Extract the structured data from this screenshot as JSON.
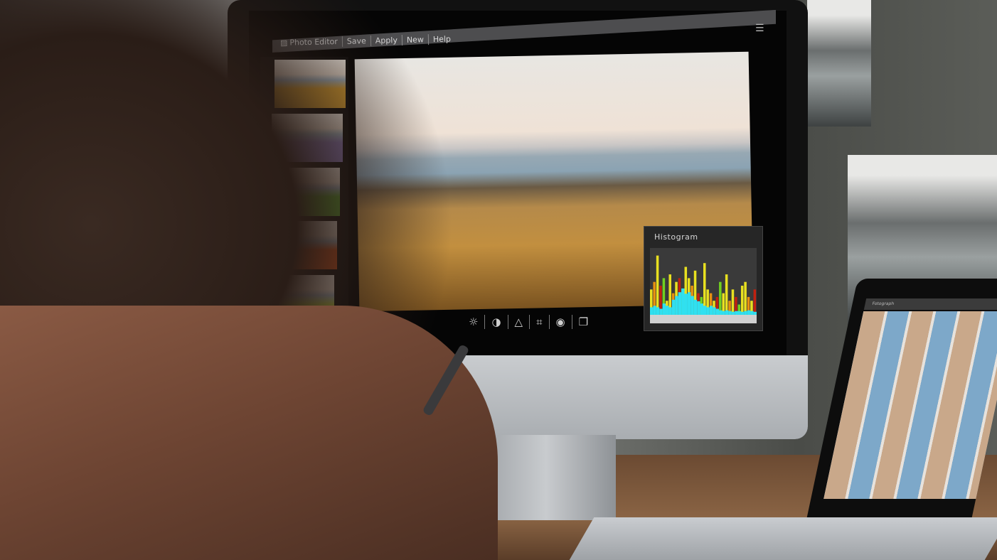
{
  "app": {
    "title": "Photo Editor",
    "menu": [
      "Save",
      "Apply",
      "New",
      "Help"
    ],
    "menu_icon": "image-icon",
    "hamburger_icon": "menu-icon"
  },
  "filmstrip": {
    "thumbnails": [
      {
        "name": "warm-golden-preset",
        "tint": "#d9a030"
      },
      {
        "name": "purple-blue-preset",
        "tint": "#8a78b8"
      },
      {
        "name": "green-preset",
        "tint": "#5aa830"
      },
      {
        "name": "red-orange-preset",
        "tint": "#d0501a"
      },
      {
        "name": "teal-yellow-preset",
        "tint": "#a8b840"
      }
    ]
  },
  "main_image": {
    "description": "Lakeside landscape with golden grass and snowy mountains"
  },
  "toolbar": {
    "tools": [
      {
        "name": "brightness",
        "icon": "sun-icon",
        "glyph": "☼"
      },
      {
        "name": "contrast",
        "icon": "contrast-icon",
        "glyph": "◑"
      },
      {
        "name": "sharpen",
        "icon": "triangle-icon",
        "glyph": "△"
      },
      {
        "name": "crop",
        "icon": "crop-icon",
        "glyph": "⌗"
      },
      {
        "name": "preview",
        "icon": "eye-icon",
        "glyph": "◉"
      },
      {
        "name": "compare",
        "icon": "copy-icon",
        "glyph": "❐"
      }
    ]
  },
  "histogram": {
    "title": "Histogram",
    "colors": {
      "yellow": "#e8e020",
      "orange": "#e89010",
      "red": "#c02010",
      "green": "#70d020",
      "cyan": "#30e0f0",
      "base": "#d0d0d0",
      "background": "#3a3a3a"
    },
    "yellow_levels": [
      0.45,
      0.55,
      0.9,
      0.5,
      0.6,
      0.3,
      0.65,
      0.4,
      0.55,
      0.6,
      0.45,
      0.75,
      0.6,
      0.5,
      0.7,
      0.4,
      0.35,
      0.8,
      0.45,
      0.4,
      0.3,
      0.35,
      0.55,
      0.4,
      0.65,
      0.3,
      0.45,
      0.35,
      0.25,
      0.5,
      0.55,
      0.35,
      0.3,
      0.45
    ],
    "cyan_levels": [
      0.1,
      0.12,
      0.1,
      0.08,
      0.15,
      0.12,
      0.1,
      0.2,
      0.25,
      0.3,
      0.35,
      0.28,
      0.3,
      0.25,
      0.2,
      0.18,
      0.15,
      0.12,
      0.1,
      0.12,
      0.1,
      0.08,
      0.06,
      0.05,
      0.06,
      0.05,
      0.04,
      0.05,
      0.05,
      0.04,
      0.05,
      0.06,
      0.05,
      0.04
    ]
  },
  "laptop": {
    "title": "Fotograph"
  }
}
